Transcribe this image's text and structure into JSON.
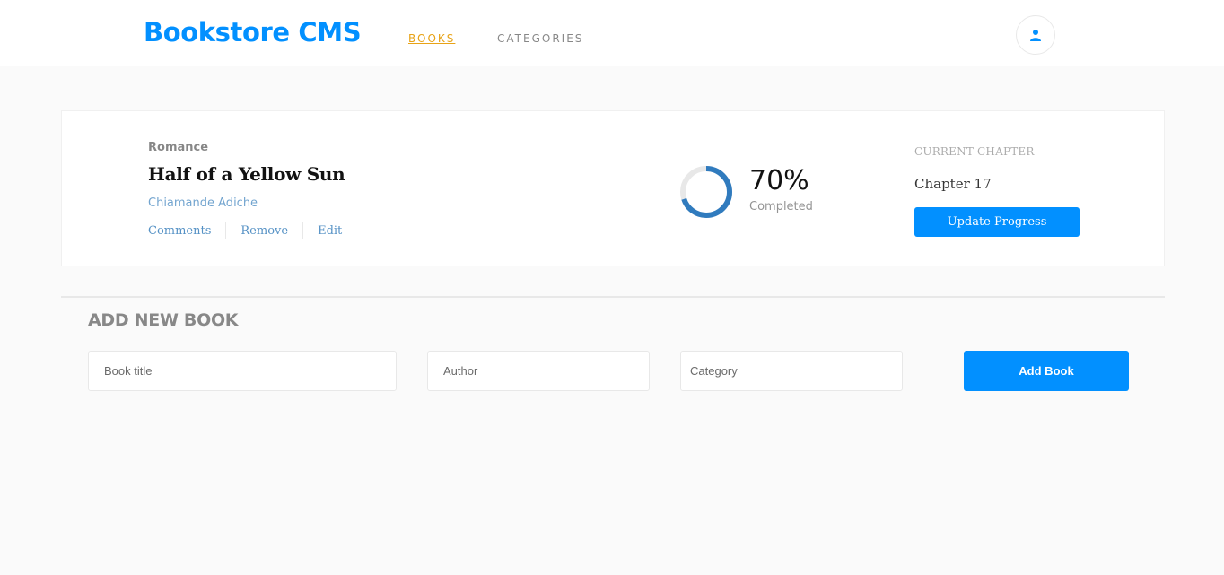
{
  "header": {
    "logo": "Bookstore CMS",
    "nav": [
      {
        "label": "BOOKS",
        "active": true
      },
      {
        "label": "CATEGORIES",
        "active": false
      }
    ],
    "user_icon": "user-icon"
  },
  "book": {
    "category": "Romance",
    "title": "Half of a Yellow Sun",
    "author": "Chiamande Adiche",
    "actions": [
      "Comments",
      "Remove",
      "Edit"
    ],
    "progress_percent": 70,
    "progress_text": "70%",
    "progress_label": "Completed",
    "current_chapter_label": "CURRENT CHAPTER",
    "current_chapter": "Chapter 17",
    "update_button": "Update Progress"
  },
  "add_form": {
    "heading": "ADD NEW BOOK",
    "title_placeholder": "Book title",
    "author_placeholder": "Author",
    "category_placeholder": "Category",
    "submit_label": "Add Book"
  },
  "colors": {
    "accent": "#0290ff",
    "active_nav": "#e8a317",
    "progress": "#307bbe",
    "progress_track": "#e8e8e8"
  }
}
